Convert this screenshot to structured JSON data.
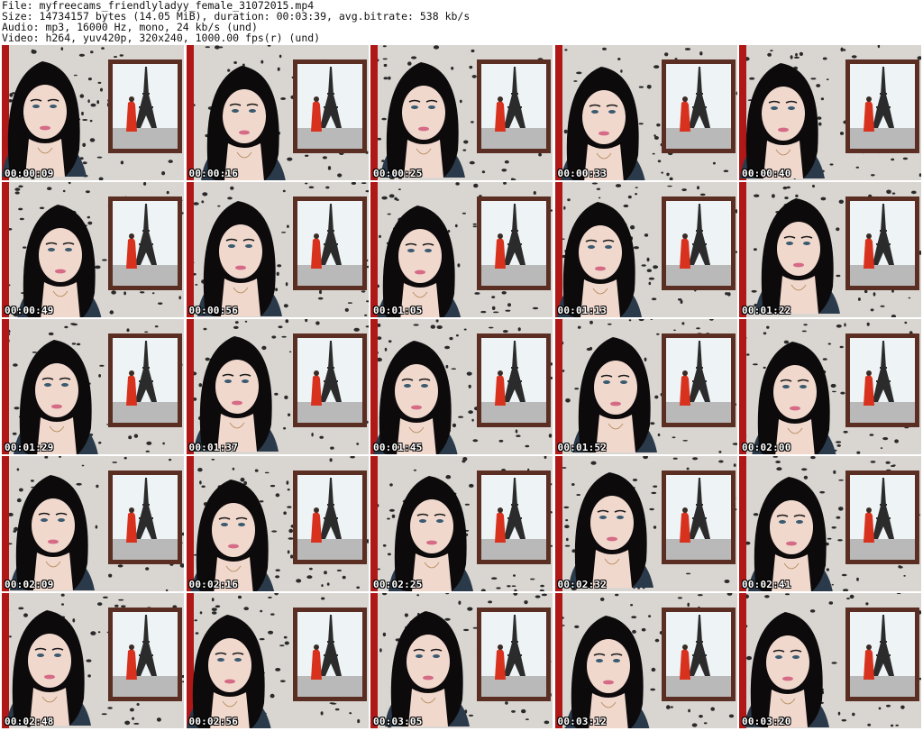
{
  "header": {
    "file": "File: myfreecams_friendlyladyy_female_31072015.mp4",
    "size": "Size: 14734157 bytes (14.05 MiB), duration: 00:03:39, avg.bitrate: 538 kb/s",
    "audio": "Audio: mp3, 16000 Hz, mono, 24 kb/s (und)",
    "video": "Video: h264, yuv420p, 320x240, 1000.00 fps(r) (und)"
  },
  "colors": {
    "wall": "#d9d6d2",
    "wall_spots": "#2a2a2a",
    "frame": "#5a2e22",
    "poster_sky": "#eef3f6",
    "tower": "#2b2b2b",
    "dress": "#d8321e",
    "hair": "#0d0a0c",
    "skin": "#f1d8cd",
    "top": "#2a3a4a",
    "curtain": "#b01818"
  },
  "thumbnails": [
    {
      "timestamp": "00:00:09"
    },
    {
      "timestamp": "00:00:16"
    },
    {
      "timestamp": "00:00:25"
    },
    {
      "timestamp": "00:00:33"
    },
    {
      "timestamp": "00:00:40"
    },
    {
      "timestamp": "00:00:49"
    },
    {
      "timestamp": "00:00:56"
    },
    {
      "timestamp": "00:01:05"
    },
    {
      "timestamp": "00:01:13"
    },
    {
      "timestamp": "00:01:22"
    },
    {
      "timestamp": "00:01:29"
    },
    {
      "timestamp": "00:01:37"
    },
    {
      "timestamp": "00:01:45"
    },
    {
      "timestamp": "00:01:52"
    },
    {
      "timestamp": "00:02:00"
    },
    {
      "timestamp": "00:02:09"
    },
    {
      "timestamp": "00:02:16"
    },
    {
      "timestamp": "00:02:25"
    },
    {
      "timestamp": "00:02:32"
    },
    {
      "timestamp": "00:02:41"
    },
    {
      "timestamp": "00:02:48"
    },
    {
      "timestamp": "00:02:56"
    },
    {
      "timestamp": "00:03:05"
    },
    {
      "timestamp": "00:03:12"
    },
    {
      "timestamp": "00:03:20"
    }
  ]
}
